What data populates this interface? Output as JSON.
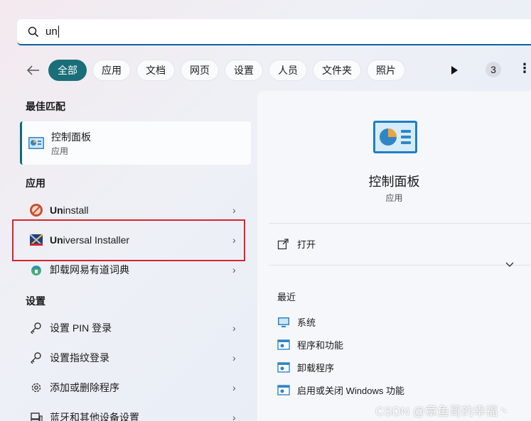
{
  "search": {
    "query": "un"
  },
  "filters": {
    "chips": [
      "全部",
      "应用",
      "文档",
      "网页",
      "设置",
      "人员",
      "文件夹",
      "照片"
    ],
    "active_index": 0,
    "count_badge": "3"
  },
  "left": {
    "best_match_title": "最佳匹配",
    "best_match": {
      "name": "控制面板",
      "type": "应用"
    },
    "apps_title": "应用",
    "apps": [
      {
        "label": "Uninstall",
        "match": "Un",
        "rest": "install",
        "icon": "uninstall-icon"
      },
      {
        "label": "Universal Installer",
        "match": "Un",
        "rest": "iversal Installer",
        "icon": "installer-icon"
      },
      {
        "label": "卸载网易有道词典",
        "icon": "youdao-icon"
      }
    ],
    "settings_title": "设置",
    "settings": [
      {
        "label": "设置 PIN 登录",
        "icon": "key-icon"
      },
      {
        "label": "设置指纹登录",
        "icon": "key-icon"
      },
      {
        "label": "添加或删除程序",
        "icon": "gear-icon"
      },
      {
        "label": "蓝牙和其他设备设置",
        "icon": "devices-icon"
      }
    ]
  },
  "right": {
    "title": "控制面板",
    "subtitle": "应用",
    "open_label": "打开",
    "recent_title": "最近",
    "recent": [
      "系统",
      "程序和功能",
      "卸载程序",
      "启用或关闭 Windows 功能"
    ]
  },
  "watermark": "CSDN @章鱼哥的幸福丶",
  "colors": {
    "accent": "#1a6e78",
    "highlight": "#d7262d",
    "search_underline": "#0e5ea8"
  }
}
